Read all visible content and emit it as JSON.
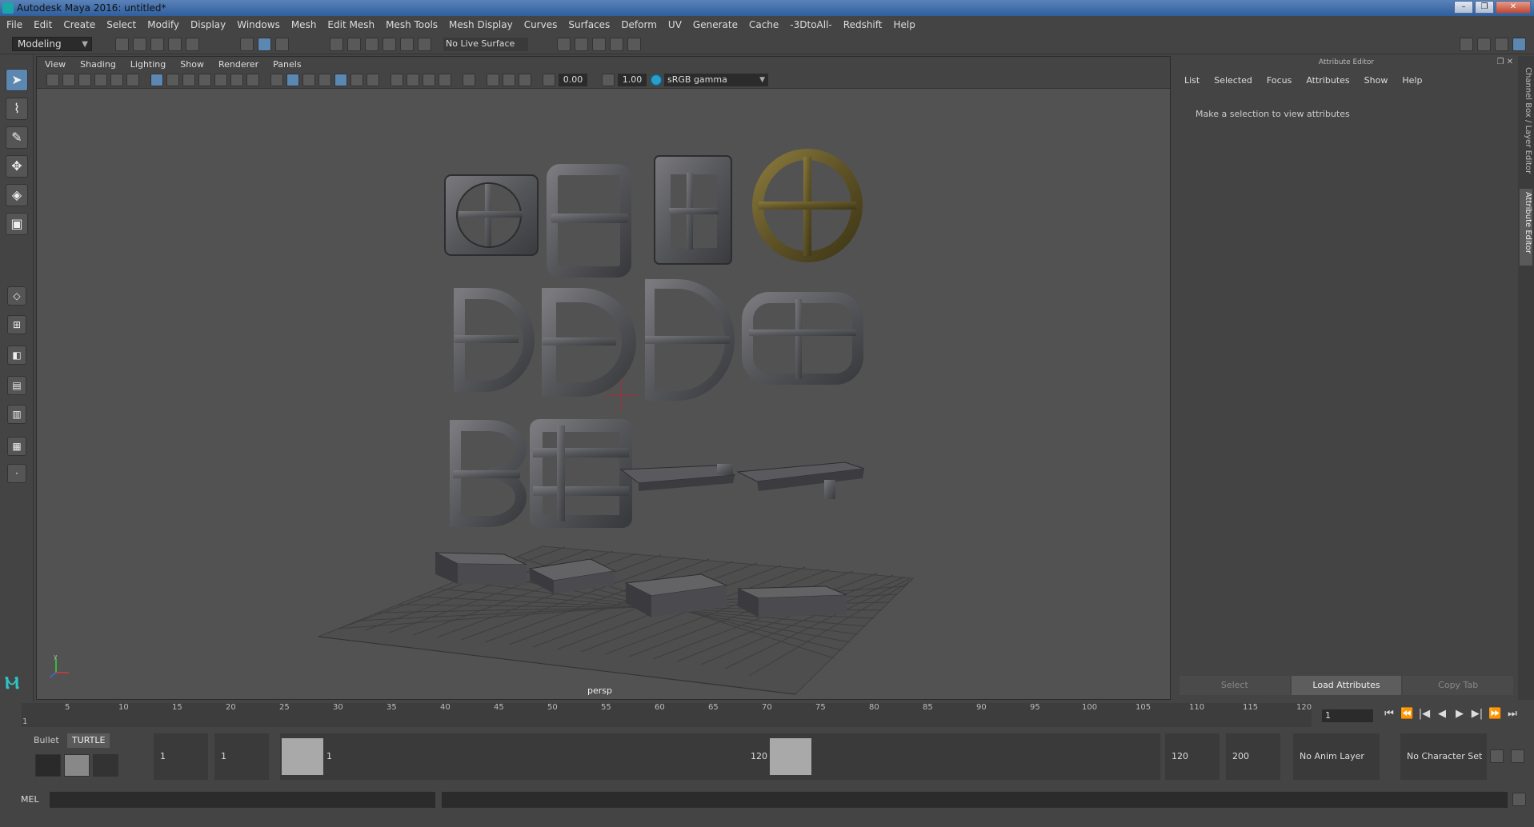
{
  "window": {
    "title": "Autodesk Maya 2016: untitled*",
    "minimize": "–",
    "maximize": "❐",
    "close": "✕"
  },
  "menubar": [
    "File",
    "Edit",
    "Create",
    "Select",
    "Modify",
    "Display",
    "Windows",
    "Mesh",
    "Edit Mesh",
    "Mesh Tools",
    "Mesh Display",
    "Curves",
    "Surfaces",
    "Deform",
    "UV",
    "Generate",
    "Cache",
    "-3DtoAll-",
    "Redshift",
    "Help"
  ],
  "status": {
    "mode": "Modeling",
    "live_surface": "No Live Surface"
  },
  "toolbox": {
    "tools": [
      "select-tool",
      "lasso-tool",
      "paint-select-tool",
      "move-tool",
      "rotate-tool",
      "scale-tool"
    ]
  },
  "viewport": {
    "menu": [
      "View",
      "Shading",
      "Lighting",
      "Show",
      "Renderer",
      "Panels"
    ],
    "exposure": "0.00",
    "gamma": "1.00",
    "colorspace": "sRGB gamma",
    "camera": "persp",
    "axis_y": "y",
    "axis_x": "x",
    "axis_z": "z"
  },
  "attribute_editor": {
    "title": "Attribute Editor",
    "menu": [
      "List",
      "Selected",
      "Focus",
      "Attributes",
      "Show",
      "Help"
    ],
    "hint": "Make a selection to view attributes",
    "buttons": [
      "Select",
      "Load Attributes",
      "Copy Tab"
    ]
  },
  "side_tabs": [
    "Channel Box / Layer Editor",
    "Attribute Editor"
  ],
  "timeline": {
    "ticks": [
      "1",
      "5",
      "10",
      "15",
      "20",
      "25",
      "30",
      "35",
      "40",
      "45",
      "50",
      "55",
      "60",
      "65",
      "70",
      "75",
      "80",
      "85",
      "90",
      "95",
      "100",
      "105",
      "110",
      "115",
      "120"
    ],
    "current_frame": "1",
    "playback": [
      "⏮",
      "⏭",
      "◀|",
      "◀",
      "▶",
      "▶|",
      "⏭",
      "⏭"
    ]
  },
  "range": {
    "shelf_tabs": [
      "Bullet",
      "TURTLE"
    ],
    "start": "1",
    "playback_start": "1",
    "range_start_label": "1",
    "range_end_label": "120",
    "playback_end": "120",
    "end": "200",
    "anim_layer": "No Anim Layer",
    "character_set": "No Character Set"
  },
  "cmdline": {
    "label": "MEL"
  }
}
